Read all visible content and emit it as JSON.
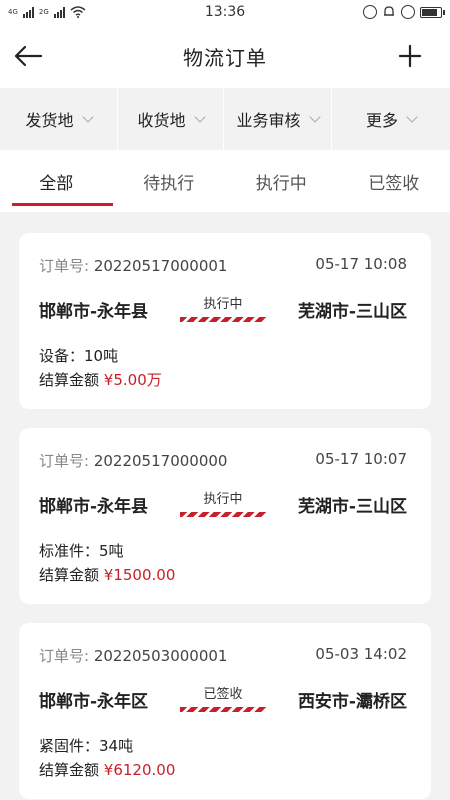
{
  "status_bar": {
    "left_icons": [
      "signal-4g-icon",
      "signal-2g-icon",
      "wifi-icon"
    ],
    "time": "13:36",
    "right_icons": [
      "lock-rotation-icon",
      "alarm-icon",
      "alarm-clock-icon",
      "battery-icon"
    ],
    "battery_level": 0.9,
    "sig1": "4G",
    "sig2": "2G"
  },
  "header": {
    "title": "物流订单",
    "back_icon": "arrow-left-icon",
    "add_icon": "plus-icon"
  },
  "filters": [
    {
      "label": "发货地"
    },
    {
      "label": "收货地"
    },
    {
      "label": "业务审核"
    },
    {
      "label": "更多"
    }
  ],
  "tabs": [
    {
      "label": "全部",
      "active": true
    },
    {
      "label": "待执行",
      "active": false
    },
    {
      "label": "执行中",
      "active": false
    },
    {
      "label": "已签收",
      "active": false
    }
  ],
  "orders": [
    {
      "order_label": "订单号:",
      "order_no": "20220517000001",
      "time": "05-17 10:08",
      "from": "邯郸市-永年县",
      "status": "执行中",
      "to": "芜湖市-三山区",
      "goods": "设备：10吨",
      "amount_label": "结算金额",
      "amount": "¥5.00万"
    },
    {
      "order_label": "订单号:",
      "order_no": "20220517000000",
      "time": "05-17 10:07",
      "from": "邯郸市-永年县",
      "status": "执行中",
      "to": "芜湖市-三山区",
      "goods": "标准件：5吨",
      "amount_label": "结算金额",
      "amount": "¥1500.00"
    },
    {
      "order_label": "订单号:",
      "order_no": "20220503000001",
      "time": "05-03 14:02",
      "from": "邯郸市-永年区",
      "status": "已签收",
      "to": "西安市-灞桥区",
      "goods": "紧固件：34吨",
      "amount_label": "结算金额",
      "amount": "¥6120.00"
    }
  ],
  "colors": {
    "accent": "#c8202a",
    "background": "#f2f2f2",
    "card": "#ffffff"
  }
}
